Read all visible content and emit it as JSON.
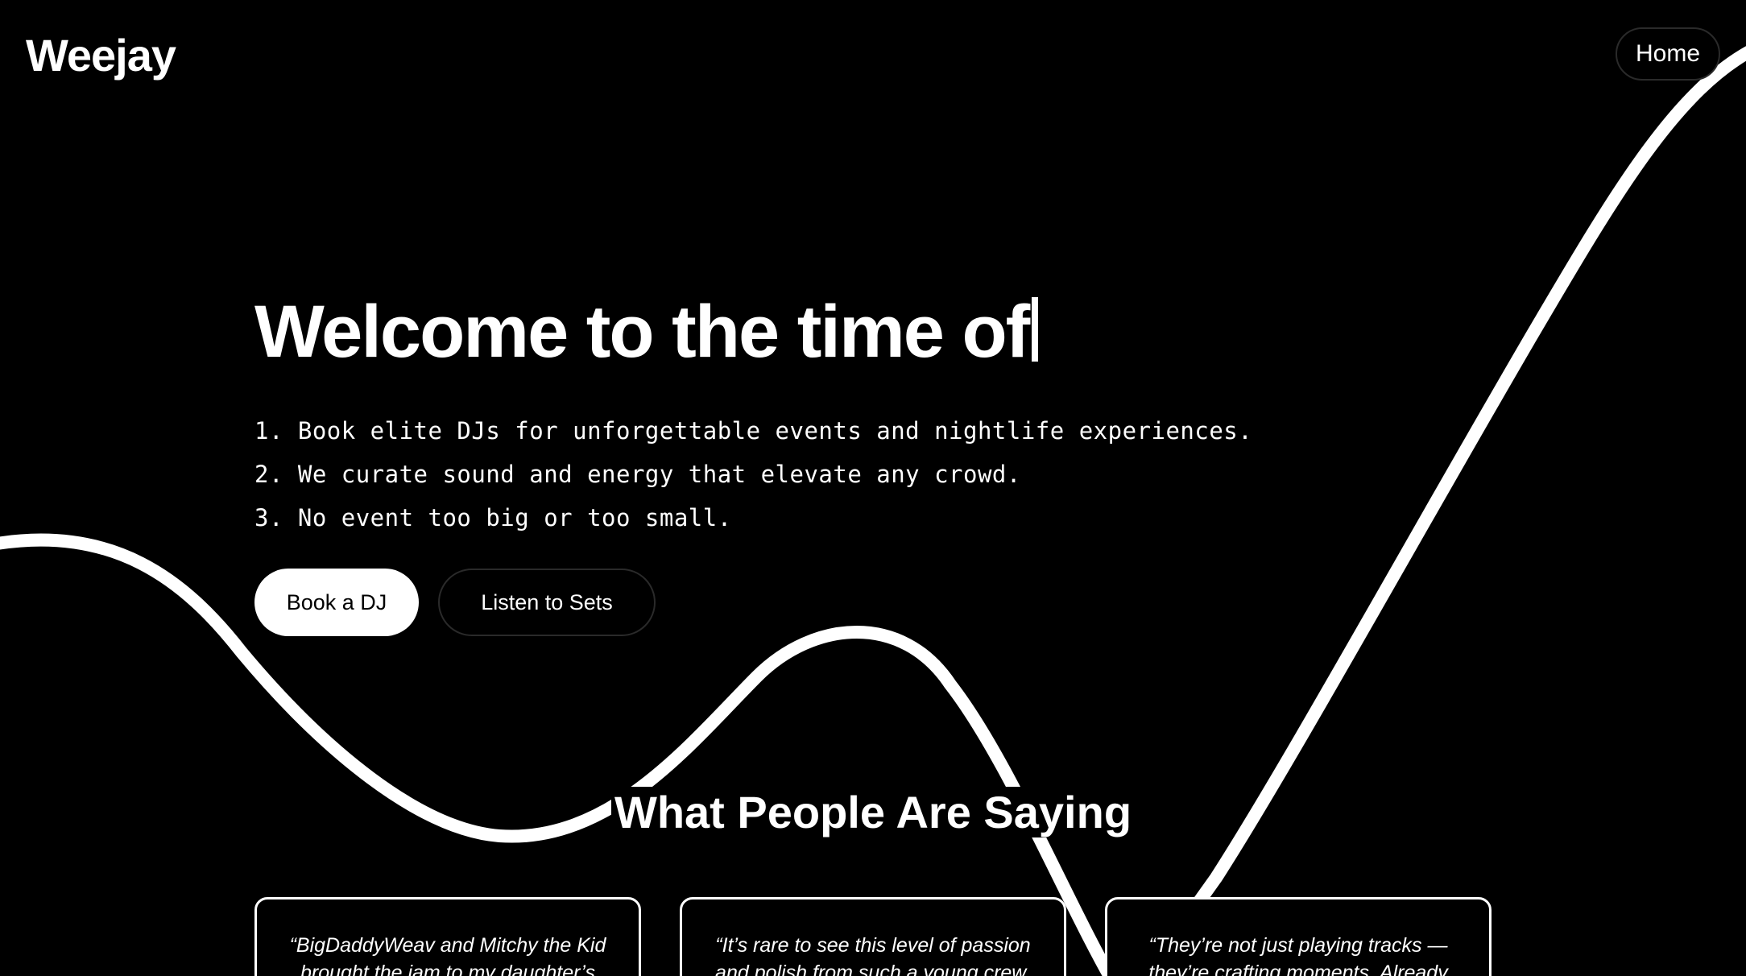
{
  "brand": {
    "logo_text": "Weejay"
  },
  "nav": {
    "home_label": "Home"
  },
  "hero": {
    "title": "Welcome to the time of",
    "points": [
      "1. Book elite DJs for unforgettable events and nightlife experiences.",
      "2. We curate sound and energy that elevate any crowd.",
      "3. No event too big or too small."
    ],
    "primary_button": "Book a DJ",
    "secondary_button": "Listen to Sets"
  },
  "testimonials": {
    "heading": "What People Are Saying",
    "items": [
      {
        "quote": "“BigDaddyWeav and Mitchy the Kid brought the jam to my daughter’s"
      },
      {
        "quote": "“It’s rare to see this level of passion and polish from such a young crew."
      },
      {
        "quote": "“They’re not just playing tracks — they’re crafting moments. Already"
      }
    ]
  },
  "colors": {
    "background": "#000000",
    "foreground": "#ffffff",
    "button_border": "#2a2a2a"
  }
}
